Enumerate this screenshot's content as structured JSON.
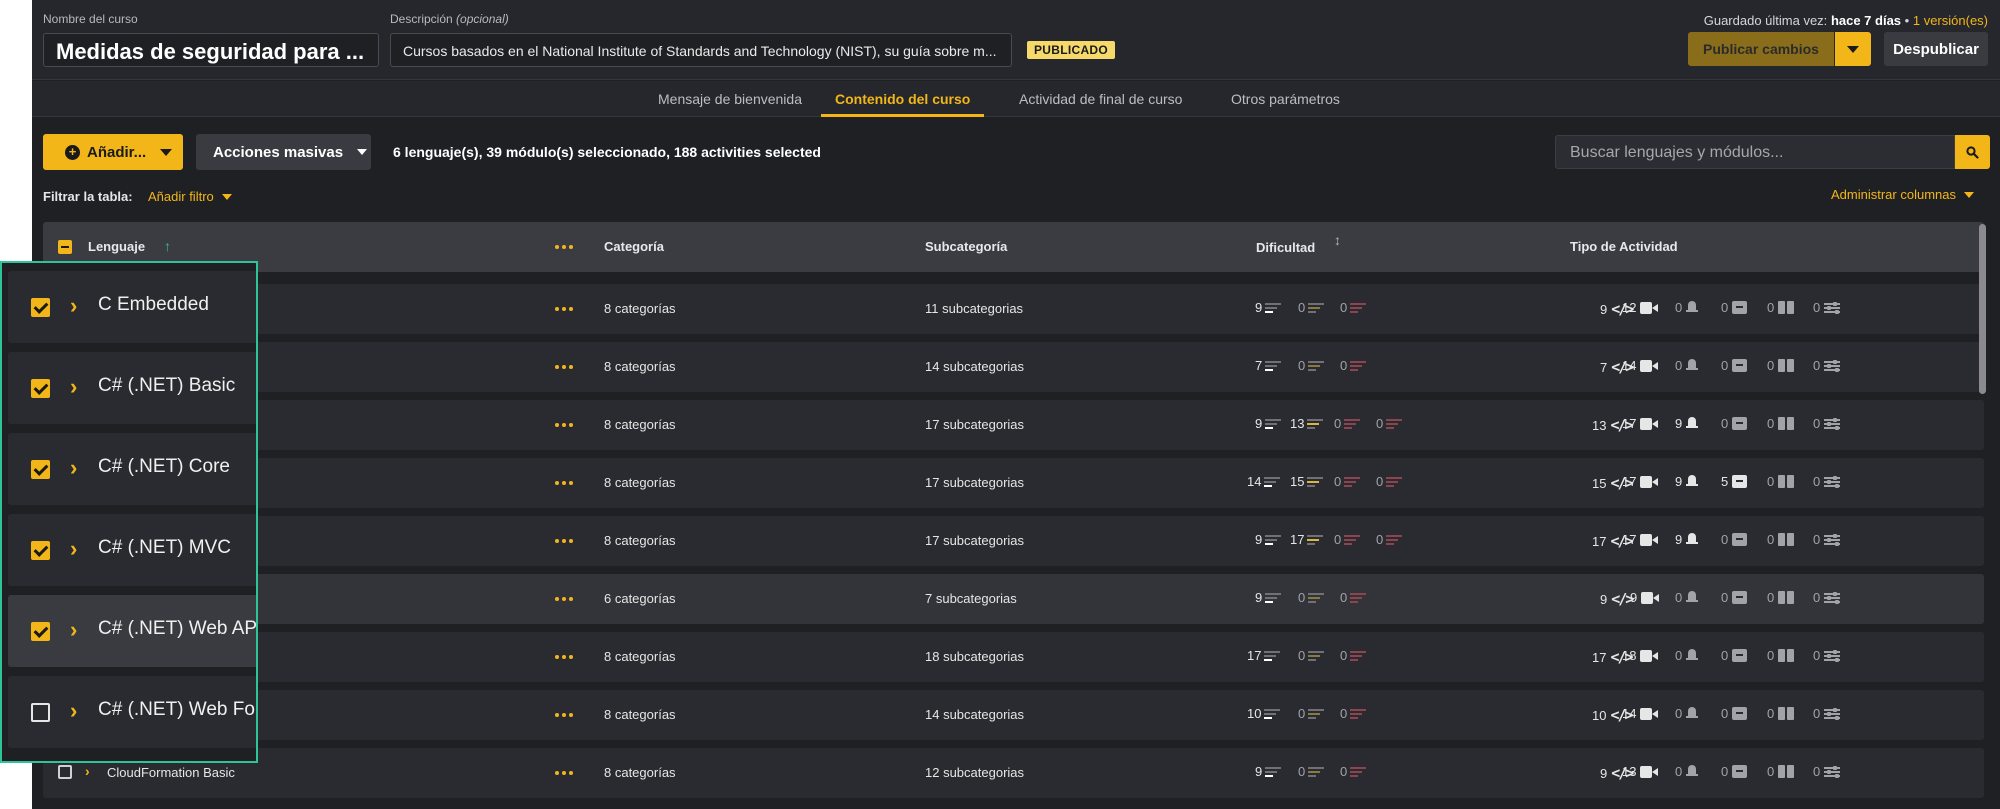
{
  "header": {
    "course_name_label": "Nombre del curso",
    "course_name": "Medidas de seguridad para ...",
    "description_label": "Descripción",
    "description_optional": "(opcional)",
    "description": "Cursos basados en el National Institute of Standards and Technology (NIST), su guía sobre m...",
    "status_badge": "PUBLICADO",
    "saved_prefix": "Guardado última vez:",
    "saved_time": "hace 7 días",
    "saved_sep": "•",
    "versions": "1 versión(es)",
    "publish_label": "Publicar cambios",
    "unpublish_label": "Despublicar"
  },
  "tabs": [
    {
      "label": "Mensaje de bienvenida",
      "active": false
    },
    {
      "label": "Contenido del curso",
      "active": true
    },
    {
      "label": "Actividad de final de curso",
      "active": false
    },
    {
      "label": "Otros parámetros",
      "active": false
    }
  ],
  "toolbar": {
    "add_label": "Añadir...",
    "bulk_label": "Acciones masivas",
    "selection_summary": "6 lenguaje(s), 39 módulo(s) seleccionado, 188 activities selected",
    "search_placeholder": "Buscar lenguajes y módulos...",
    "filter_label": "Filtrar la tabla:",
    "add_filter": "Añadir filtro",
    "manage_columns": "Administrar columnas"
  },
  "table": {
    "columns": {
      "language": "Lenguaje",
      "category": "Categoría",
      "subcategory": "Subcategoría",
      "difficulty": "Dificultad",
      "activity_type": "Tipo de Actividad"
    },
    "rows": [
      {
        "name": "C Embedded",
        "checked": true,
        "category": "8 categorías",
        "subcategory": "11 subcategorias",
        "difficulty": [
          "9",
          "0",
          "0"
        ],
        "activities": [
          "9",
          "12",
          "0",
          "0",
          "0",
          "0"
        ]
      },
      {
        "name": "C# (.NET) Basic",
        "checked": true,
        "category": "8 categorías",
        "subcategory": "14 subcategorias",
        "difficulty": [
          "7",
          "0",
          "0"
        ],
        "activities": [
          "7",
          "14",
          "0",
          "0",
          "0",
          "0"
        ]
      },
      {
        "name": "C# (.NET) Core",
        "checked": true,
        "category": "8 categorías",
        "subcategory": "17 subcategorias",
        "difficulty": [
          "9",
          "13",
          "0",
          "0"
        ],
        "activities": [
          "13",
          "17",
          "9",
          "0",
          "0",
          "0"
        ]
      },
      {
        "name": "C# (.NET) MVC",
        "checked": true,
        "category": "8 categorías",
        "subcategory": "17 subcategorias",
        "difficulty": [
          "14",
          "15",
          "0",
          "0"
        ],
        "activities": [
          "15",
          "17",
          "9",
          "5",
          "0",
          "0"
        ]
      },
      {
        "name": "C# (.NET) Web API",
        "checked": true,
        "category": "8 categorías",
        "subcategory": "17 subcategorias",
        "difficulty": [
          "9",
          "17",
          "0",
          "0"
        ],
        "activities": [
          "17",
          "17",
          "9",
          "0",
          "0",
          "0"
        ]
      },
      {
        "name": "C# (.NET) Web Forms",
        "checked": false,
        "category": "6 categorías",
        "subcategory": "7 subcategorias",
        "difficulty": [
          "9",
          "0",
          "0"
        ],
        "activities": [
          "9",
          "9",
          "0",
          "0",
          "0",
          "0"
        ]
      },
      {
        "name": "",
        "checked": false,
        "category": "8 categorías",
        "subcategory": "18 subcategorias",
        "difficulty": [
          "17",
          "0",
          "0"
        ],
        "activities": [
          "17",
          "18",
          "0",
          "0",
          "0",
          "0"
        ]
      },
      {
        "name": "",
        "checked": false,
        "category": "8 categorías",
        "subcategory": "14 subcategorias",
        "difficulty": [
          "10",
          "0",
          "0"
        ],
        "activities": [
          "10",
          "14",
          "0",
          "0",
          "0",
          "0"
        ]
      },
      {
        "name": "CloudFormation Basic",
        "checked": false,
        "category": "8 categorías",
        "subcategory": "12 subcategorias",
        "difficulty": [
          "9",
          "0",
          "0"
        ],
        "activities": [
          "9",
          "13",
          "0",
          "0",
          "0",
          "0"
        ]
      }
    ]
  },
  "zoom_panel": {
    "items": [
      {
        "name": "C Embedded",
        "checked": true
      },
      {
        "name": "C# (.NET) Basic",
        "checked": true
      },
      {
        "name": "C# (.NET) Core",
        "checked": true
      },
      {
        "name": "C# (.NET) MVC",
        "checked": true
      },
      {
        "name": "C# (.NET) Web API",
        "checked": true
      },
      {
        "name": "C# (.NET) Web Form",
        "checked": false
      }
    ]
  },
  "icons": {
    "add": "plus-circle-icon",
    "search": "search-icon",
    "activity_types": [
      "code-icon",
      "video-icon",
      "bell-icon",
      "interactive-icon",
      "book-icon",
      "sliders-icon"
    ]
  },
  "colors": {
    "accent": "#f2b619",
    "background": "#1f2024",
    "highlight_border": "#2ec49a"
  }
}
